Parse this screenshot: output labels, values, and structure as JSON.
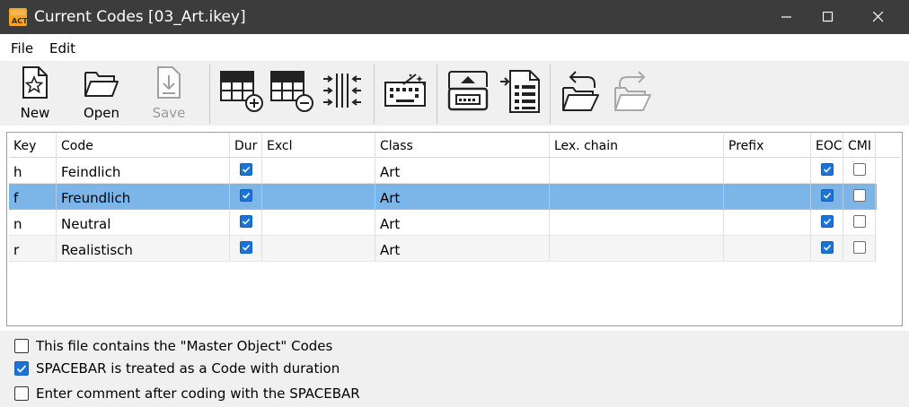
{
  "window": {
    "title": "Current Codes [03_Art.ikey]",
    "app_icon_text": "ACT",
    "controls": [
      "minimize",
      "maximize",
      "close"
    ]
  },
  "menu": {
    "items": [
      "File",
      "Edit"
    ]
  },
  "toolbar": {
    "buttons": [
      {
        "label": "New",
        "icon": "new-file-icon",
        "enabled": true
      },
      {
        "label": "Open",
        "icon": "open-folder-icon",
        "enabled": true
      },
      {
        "label": "Save",
        "icon": "save-icon",
        "enabled": false
      },
      {
        "label": "",
        "icon": "add-row-icon",
        "enabled": true
      },
      {
        "label": "",
        "icon": "remove-row-icon",
        "enabled": true
      },
      {
        "label": "",
        "icon": "columns-icon",
        "enabled": true
      },
      {
        "label": "",
        "icon": "magic-keyboard-icon",
        "enabled": true
      },
      {
        "label": "",
        "icon": "import-icon",
        "enabled": true
      },
      {
        "label": "",
        "icon": "export-list-icon",
        "enabled": true
      },
      {
        "label": "",
        "icon": "open-back-icon",
        "enabled": true
      },
      {
        "label": "",
        "icon": "open-forward-icon",
        "enabled": false
      }
    ]
  },
  "table": {
    "columns": [
      "Key",
      "Code",
      "Dur",
      "Excl",
      "Class",
      "Lex. chain",
      "Prefix",
      "EOC",
      "CMI"
    ],
    "rows": [
      {
        "key": "h",
        "code": "Feindlich",
        "dur": true,
        "excl": "",
        "class": "Art",
        "lex_chain": "",
        "prefix": "",
        "eoc": true,
        "cmi": false,
        "selected": false
      },
      {
        "key": "f",
        "code": "Freundlich",
        "dur": true,
        "excl": "",
        "class": "Art",
        "lex_chain": "",
        "prefix": "",
        "eoc": true,
        "cmi": false,
        "selected": true
      },
      {
        "key": "n",
        "code": "Neutral",
        "dur": true,
        "excl": "",
        "class": "Art",
        "lex_chain": "",
        "prefix": "",
        "eoc": true,
        "cmi": false,
        "selected": false
      },
      {
        "key": "r",
        "code": "Realistisch",
        "dur": true,
        "excl": "",
        "class": "Art",
        "lex_chain": "",
        "prefix": "",
        "eoc": true,
        "cmi": false,
        "selected": false
      }
    ]
  },
  "options": [
    {
      "label": "This file contains the \"Master Object\" Codes",
      "checked": false
    },
    {
      "label": "SPACEBAR is treated as a Code with duration",
      "checked": true
    },
    {
      "label": "Enter comment after coding with the SPACEBAR",
      "checked": false
    }
  ],
  "colors": {
    "titlebar": "#3c3c3c",
    "selection": "#7cb5e8",
    "checkbox_accent": "#1a73d6",
    "app_icon": "#f5a623"
  }
}
